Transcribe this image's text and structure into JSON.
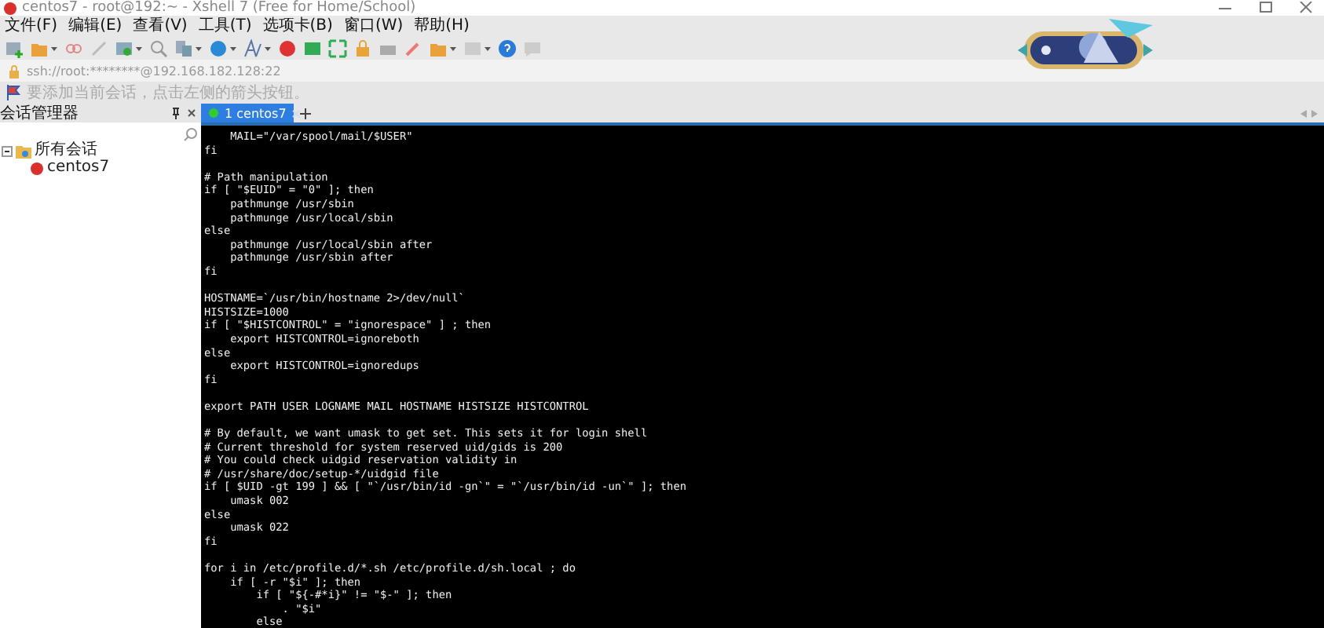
{
  "window": {
    "title": "centos7 - root@192:~ - Xshell 7 (Free for Home/School)"
  },
  "menu": [
    "文件(F)",
    "编辑(E)",
    "查看(V)",
    "工具(T)",
    "选项卡(B)",
    "窗口(W)",
    "帮助(H)"
  ],
  "address": {
    "value": "ssh://root:********@192.168.182.128:22"
  },
  "hint": "要添加当前会话，点击左侧的箭头按钮。",
  "session_manager": {
    "title": "会话管理器",
    "tree": [
      {
        "label": "所有会话",
        "expanded": true,
        "children": [
          {
            "label": "centos7"
          }
        ]
      }
    ]
  },
  "tabs": [
    {
      "label": "1 centos7",
      "selected": true
    }
  ],
  "terminal": {
    "blocks": [
      [
        "    MAIL=\"/var/spool/mail/$USER\"",
        "fi"
      ],
      [
        "# Path manipulation",
        "if [ \"$EUID\" = \"0\" ]; then",
        "    pathmunge /usr/sbin",
        "    pathmunge /usr/local/sbin",
        "else",
        "    pathmunge /usr/local/sbin after",
        "    pathmunge /usr/sbin after",
        "fi"
      ],
      [
        "HOSTNAME=`/usr/bin/hostname 2>/dev/null`",
        "HISTSIZE=1000",
        "if [ \"$HISTCONTROL\" = \"ignorespace\" ] ; then",
        "    export HISTCONTROL=ignoreboth",
        "else",
        "    export HISTCONTROL=ignoredups",
        "fi"
      ],
      [
        "export PATH USER LOGNAME MAIL HOSTNAME HISTSIZE HISTCONTROL"
      ],
      [
        "# By default, we want umask to get set. This sets it for login shell",
        "# Current threshold for system reserved uid/gids is 200",
        "# You could check uidgid reservation validity in",
        "# /usr/share/doc/setup-*/uidgid file",
        "if [ $UID -gt 199 ] && [ \"`/usr/bin/id -gn`\" = \"`/usr/bin/id -un`\" ]; then",
        "    umask 002",
        "else",
        "    umask 022",
        "fi"
      ],
      [
        "for i in /etc/profile.d/*.sh /etc/profile.d/sh.local ; do",
        "    if [ -r \"$i\" ]; then",
        "        if [ \"${-#*i}\" != \"$-\" ]; then",
        "            . \"$i\"",
        "        else"
      ]
    ]
  }
}
